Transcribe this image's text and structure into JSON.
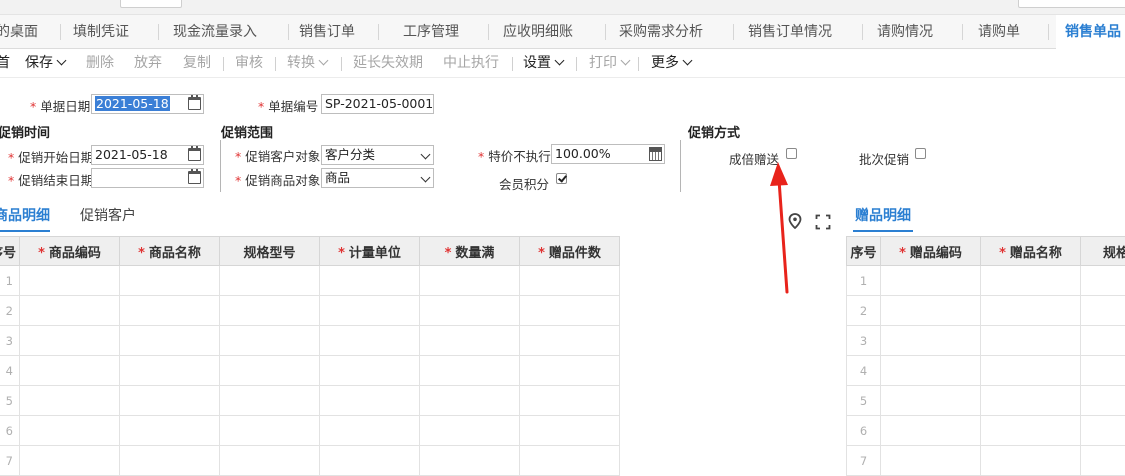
{
  "tabs": [
    {
      "label": "的桌面",
      "active": false
    },
    {
      "label": "填制凭证",
      "active": false
    },
    {
      "label": "现金流量录入",
      "active": false
    },
    {
      "label": "销售订单",
      "active": false
    },
    {
      "label": "工序管理",
      "active": false
    },
    {
      "label": "应收明细账",
      "active": false
    },
    {
      "label": "采购需求分析",
      "active": false
    },
    {
      "label": "销售订单情况",
      "active": false
    },
    {
      "label": "请购情况",
      "active": false
    },
    {
      "label": "请购单",
      "active": false
    },
    {
      "label": "销售单品",
      "active": true
    }
  ],
  "toolbar": {
    "first": "首",
    "save": "保存",
    "delete": "删除",
    "discard": "放弃",
    "copy": "复制",
    "audit": "审核",
    "convert": "转换",
    "extend": "延长失效期",
    "stop": "中止执行",
    "settings": "设置",
    "print": "打印",
    "more": "更多"
  },
  "form": {
    "doc_date_label": "单据日期",
    "doc_date_value": "2021-05-18",
    "doc_no_label": "单据编号",
    "doc_no_value": "SP-2021-05-0001",
    "promo_time_title": "促销时间",
    "start_date_label": "促销开始日期",
    "start_date_value": "2021-05-18",
    "end_date_label": "促销结束日期",
    "end_date_value": "",
    "promo_scope_title": "促销范围",
    "customer_target_label": "促销客户对象",
    "customer_target_value": "客户分类",
    "product_target_label": "促销商品对象",
    "product_target_value": "商品",
    "special_price_label": "特价不执行",
    "special_price_value": "100.00%",
    "member_points_label": "会员积分",
    "member_points_checked": true,
    "promo_method_title": "促销方式",
    "multiple_gift_label": "成倍赠送",
    "multiple_gift_checked": false,
    "batch_promo_label": "批次促销",
    "batch_promo_checked": false
  },
  "left_tabs": {
    "product_detail": "商品明细",
    "promo_customer": "促销客户"
  },
  "left_table": {
    "columns": [
      "序号",
      "商品编码",
      "商品名称",
      "规格型号",
      "计量单位",
      "数量满",
      "赠品件数"
    ],
    "required": [
      false,
      true,
      true,
      false,
      true,
      true,
      true
    ],
    "rows": [
      "1",
      "2",
      "3",
      "4",
      "5",
      "6",
      "7"
    ]
  },
  "right_tab": "赠品明细",
  "right_table": {
    "columns": [
      "序号",
      "赠品编码",
      "赠品名称",
      "规格"
    ],
    "required": [
      false,
      true,
      true,
      false
    ],
    "rows": [
      "1",
      "2",
      "3",
      "4",
      "5",
      "6",
      "7"
    ]
  },
  "colors": {
    "accent": "#2b7fd2",
    "required": "#e03333",
    "arrow": "#e8231b"
  },
  "icons": [
    "location-icon",
    "fullscreen-icon",
    "calendar-icon",
    "calculator-icon"
  ]
}
